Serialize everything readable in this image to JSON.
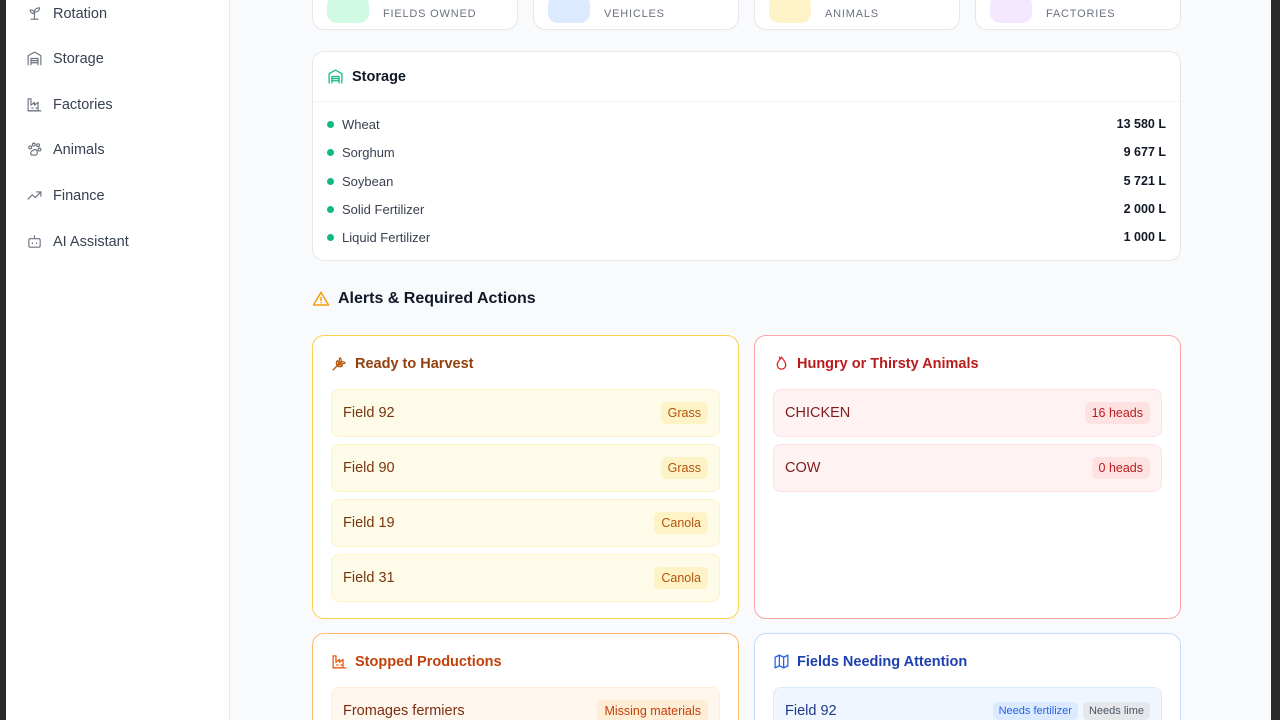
{
  "sidebar": {
    "items": [
      {
        "label": "Rotation",
        "icon": "sprout-icon"
      },
      {
        "label": "Storage",
        "icon": "warehouse-icon"
      },
      {
        "label": "Factories",
        "icon": "factory-icon"
      },
      {
        "label": "Animals",
        "icon": "paw-icon"
      },
      {
        "label": "Finance",
        "icon": "trending-up-icon"
      },
      {
        "label": "AI Assistant",
        "icon": "bot-icon"
      }
    ]
  },
  "stats": [
    {
      "label": "FIELDS OWNED",
      "color": "#d1fae5"
    },
    {
      "label": "VEHICLES",
      "color": "#dbeafe"
    },
    {
      "label": "ANIMALS",
      "color": "#fef3c7"
    },
    {
      "label": "FACTORIES",
      "color": "#f3e8ff"
    }
  ],
  "storage": {
    "title": "Storage",
    "items": [
      {
        "name": "Wheat",
        "value": "13 580 L"
      },
      {
        "name": "Sorghum",
        "value": "9 677 L"
      },
      {
        "name": "Soybean",
        "value": "5 721 L"
      },
      {
        "name": "Solid Fertilizer",
        "value": "2 000 L"
      },
      {
        "name": "Liquid Fertilizer",
        "value": "1 000 L"
      }
    ]
  },
  "alerts": {
    "title": "Alerts & Required Actions",
    "harvest": {
      "title": "Ready to Harvest",
      "items": [
        {
          "name": "Field 92",
          "badge": "Grass"
        },
        {
          "name": "Field 90",
          "badge": "Grass"
        },
        {
          "name": "Field 19",
          "badge": "Canola"
        },
        {
          "name": "Field 31",
          "badge": "Canola"
        }
      ]
    },
    "animals": {
      "title": "Hungry or Thirsty Animals",
      "items": [
        {
          "name": "CHICKEN",
          "badge": "16 heads"
        },
        {
          "name": "COW",
          "badge": "0 heads"
        }
      ]
    },
    "productions": {
      "title": "Stopped Productions",
      "items": [
        {
          "name": "Fromages fermiers",
          "badge": "Missing materials"
        }
      ]
    },
    "fields": {
      "title": "Fields Needing Attention",
      "items": [
        {
          "name": "Field 92",
          "badges": [
            "Needs fertilizer",
            "Needs lime"
          ]
        }
      ]
    }
  },
  "colors": {
    "accent_green": "#10b981",
    "harvest": "#92400e",
    "animals": "#b91c1c",
    "productions": "#c2410c",
    "fields": "#1e40af"
  }
}
